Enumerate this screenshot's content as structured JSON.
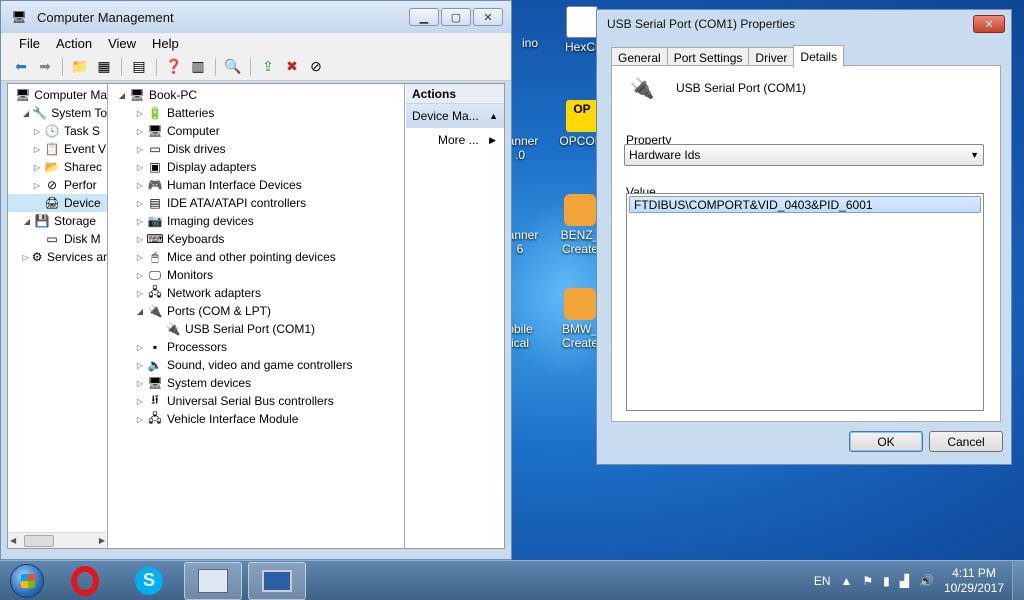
{
  "desktop": {
    "icons": [
      {
        "label": "ino",
        "sub": ""
      },
      {
        "label": "HexCr",
        "sub": ""
      },
      {
        "label": "canner",
        "sub": ".0"
      },
      {
        "label": "OPCOM",
        "sub": ""
      },
      {
        "label": "canner",
        "sub": "6"
      },
      {
        "label": "BENZ_",
        "sub": "Create"
      },
      {
        "label": "obile",
        "sub": "ical"
      },
      {
        "label": "BMW_",
        "sub": "Create"
      }
    ],
    "op_badge": "OP"
  },
  "cm": {
    "title": "Computer Management",
    "menu": [
      "File",
      "Action",
      "View",
      "Help"
    ],
    "left_tree": [
      {
        "label": "Computer Ma",
        "indent": 0,
        "arrow": "",
        "icon": "computer-management-icon"
      },
      {
        "label": "System To",
        "indent": 1,
        "arrow": "◢",
        "icon": "system-tools-icon"
      },
      {
        "label": "Task S",
        "indent": 2,
        "arrow": "▷",
        "icon": "task-scheduler-icon"
      },
      {
        "label": "Event V",
        "indent": 2,
        "arrow": "▷",
        "icon": "event-viewer-icon"
      },
      {
        "label": "Sharec",
        "indent": 2,
        "arrow": "▷",
        "icon": "shared-folders-icon"
      },
      {
        "label": "Perfor",
        "indent": 2,
        "arrow": "▷",
        "icon": "performance-icon"
      },
      {
        "label": "Device",
        "indent": 2,
        "arrow": "",
        "icon": "device-manager-icon",
        "selected": true
      },
      {
        "label": "Storage",
        "indent": 1,
        "arrow": "◢",
        "icon": "storage-icon"
      },
      {
        "label": "Disk M",
        "indent": 2,
        "arrow": "",
        "icon": "disk-management-icon"
      },
      {
        "label": "Services ar",
        "indent": 1,
        "arrow": "▷",
        "icon": "services-icon"
      }
    ],
    "device_tree": [
      {
        "label": "Book-PC",
        "indent": 0,
        "arrow": "◢",
        "icon": "pc-icon"
      },
      {
        "label": "Batteries",
        "indent": 1,
        "arrow": "▷",
        "icon": "battery-icon"
      },
      {
        "label": "Computer",
        "indent": 1,
        "arrow": "▷",
        "icon": "computer-icon"
      },
      {
        "label": "Disk drives",
        "indent": 1,
        "arrow": "▷",
        "icon": "disk-drive-icon"
      },
      {
        "label": "Display adapters",
        "indent": 1,
        "arrow": "▷",
        "icon": "display-adapter-icon"
      },
      {
        "label": "Human Interface Devices",
        "indent": 1,
        "arrow": "▷",
        "icon": "hid-icon"
      },
      {
        "label": "IDE ATA/ATAPI controllers",
        "indent": 1,
        "arrow": "▷",
        "icon": "ide-icon"
      },
      {
        "label": "Imaging devices",
        "indent": 1,
        "arrow": "▷",
        "icon": "camera-icon"
      },
      {
        "label": "Keyboards",
        "indent": 1,
        "arrow": "▷",
        "icon": "keyboard-icon"
      },
      {
        "label": "Mice and other pointing devices",
        "indent": 1,
        "arrow": "▷",
        "icon": "mouse-icon"
      },
      {
        "label": "Monitors",
        "indent": 1,
        "arrow": "▷",
        "icon": "monitor-icon"
      },
      {
        "label": "Network adapters",
        "indent": 1,
        "arrow": "▷",
        "icon": "network-icon"
      },
      {
        "label": "Ports (COM & LPT)",
        "indent": 1,
        "arrow": "◢",
        "icon": "port-icon"
      },
      {
        "label": "USB Serial Port (COM1)",
        "indent": 2,
        "arrow": "",
        "icon": "serial-port-icon"
      },
      {
        "label": "Processors",
        "indent": 1,
        "arrow": "▷",
        "icon": "processor-icon"
      },
      {
        "label": "Sound, video and game controllers",
        "indent": 1,
        "arrow": "▷",
        "icon": "sound-icon"
      },
      {
        "label": "System devices",
        "indent": 1,
        "arrow": "▷",
        "icon": "system-devices-icon"
      },
      {
        "label": "Universal Serial Bus controllers",
        "indent": 1,
        "arrow": "▷",
        "icon": "usb-icon"
      },
      {
        "label": "Vehicle Interface Module",
        "indent": 1,
        "arrow": "▷",
        "icon": "vehicle-module-icon"
      }
    ],
    "actions": {
      "header": "Actions",
      "section": "Device Ma...",
      "item": "More ..."
    }
  },
  "dialog": {
    "title": "USB Serial Port (COM1) Properties",
    "tabs": [
      "General",
      "Port Settings",
      "Driver",
      "Details"
    ],
    "active_tab": "Details",
    "device_name": "USB Serial Port (COM1)",
    "property_label": "Property",
    "property_value": "Hardware Ids",
    "value_label": "Value",
    "values": [
      "FTDIBUS\\COMPORT&VID_0403&PID_6001"
    ],
    "ok": "OK",
    "cancel": "Cancel"
  },
  "taskbar": {
    "lang": "EN",
    "time": "4:11 PM",
    "date": "10/29/2017"
  },
  "colors": {
    "accent": "#3c7fb1",
    "selection": "#cde6f7",
    "close_red": "#c8412a"
  }
}
